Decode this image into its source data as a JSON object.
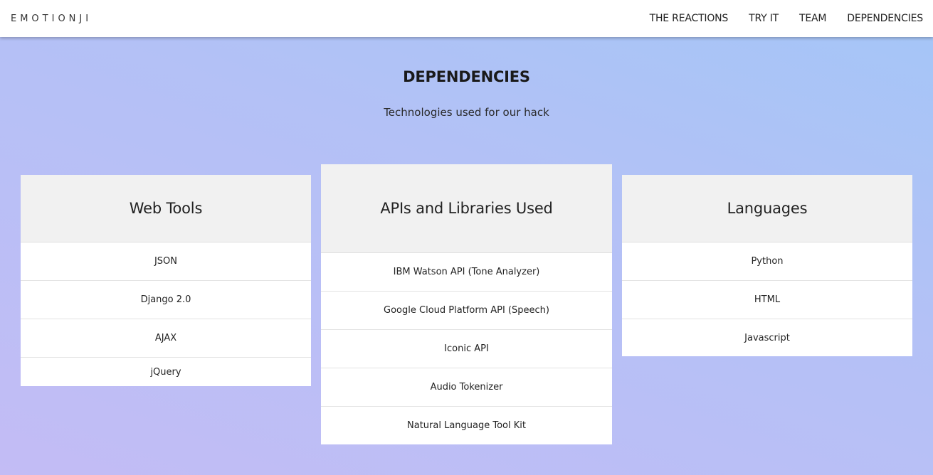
{
  "navbar": {
    "brand": "EMOTIONJI",
    "links": [
      "THE REACTIONS",
      "TRY IT",
      "TEAM",
      "DEPENDENCIES"
    ]
  },
  "section": {
    "title": "DEPENDENCIES",
    "subtitle": "Technologies used for our hack"
  },
  "cards": [
    {
      "title": "Web Tools",
      "items": [
        "JSON",
        "Django 2.0",
        "AJAX",
        "jQuery"
      ]
    },
    {
      "title": "APIs and Libraries Used",
      "items": [
        "IBM Watson API (Tone Analyzer)",
        "Google Cloud Platform API (Speech)",
        "Iconic API",
        "Audio Tokenizer",
        "Natural Language Tool Kit"
      ]
    },
    {
      "title": "Languages",
      "items": [
        "Python",
        "HTML",
        "Javascript"
      ]
    }
  ]
}
